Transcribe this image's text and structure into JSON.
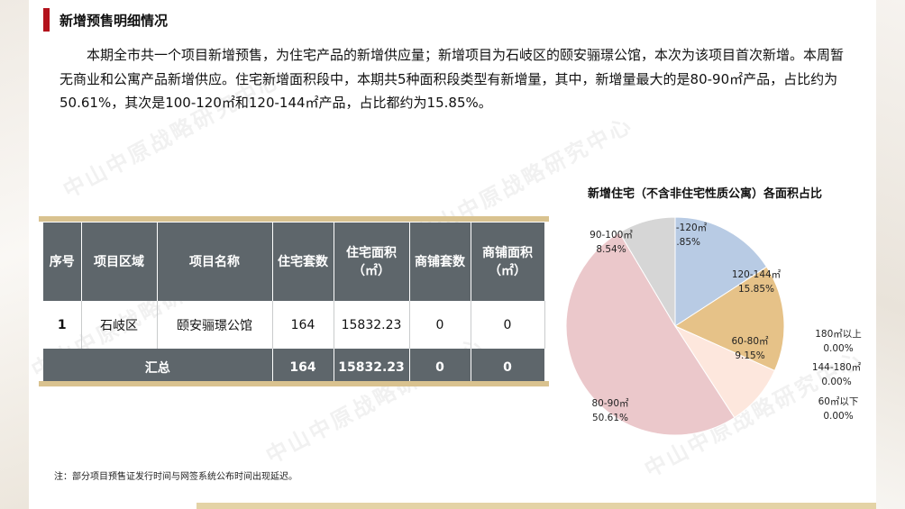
{
  "header": {
    "title": "新增预售明细情况"
  },
  "paragraph": "本期全市共一个项目新增预售，为住宅产品的新增供应量；新增项目为石岐区的颐安骊璟公馆，本次为该项目首次新增。本周暂无商业和公寓产品新增供应。住宅新增面积段中，本期共5种面积段类型有新增量，其中，新增量最大的是80-90㎡产品，占比约为50.61%，其次是100-120㎡和120-144㎡产品，占比都约为15.85%。",
  "watermark": "中山中原战略研究中心",
  "table": {
    "headers": [
      "序号",
      "项目区域",
      "项目名称",
      "住宅套数",
      "住宅面积\n（㎡）",
      "商铺套数",
      "商铺面积\n（㎡）"
    ],
    "rows": [
      [
        "1",
        "石岐区",
        "颐安骊璟公馆",
        "164",
        "15832.23",
        "0",
        "0"
      ]
    ],
    "total": {
      "label": "汇总",
      "values": [
        "164",
        "15832.23",
        "0",
        "0"
      ]
    }
  },
  "note": "注：部分项目预售证发行时间与网签系统公布时间出现延迟。",
  "chart_data": {
    "type": "pie",
    "title": "新增住宅（不含非住宅性质公寓）各面积占比",
    "slices": [
      {
        "label": "100-120㎡",
        "value": 15.85,
        "display": "15.85%",
        "color": "#b8cbe4"
      },
      {
        "label": "120-144㎡",
        "value": 15.85,
        "display": "15.85%",
        "color": "#e6c288"
      },
      {
        "label": "60-80㎡",
        "value": 9.15,
        "display": "9.15%",
        "color": "#fde7dd"
      },
      {
        "label": "180㎡以上",
        "value": 0,
        "display": "0.00%",
        "color": "#f4d6a7"
      },
      {
        "label": "144-180㎡",
        "value": 0,
        "display": "0.00%",
        "color": "#d6d6d6"
      },
      {
        "label": "60㎡以下",
        "value": 0,
        "display": "0.00%",
        "color": "#9fb8d8"
      },
      {
        "label": "80-90㎡",
        "value": 50.61,
        "display": "50.61%",
        "color": "#ebc8cb"
      },
      {
        "label": "90-100㎡",
        "value": 8.54,
        "display": "8.54%",
        "color": "#d6d6d6"
      }
    ]
  }
}
